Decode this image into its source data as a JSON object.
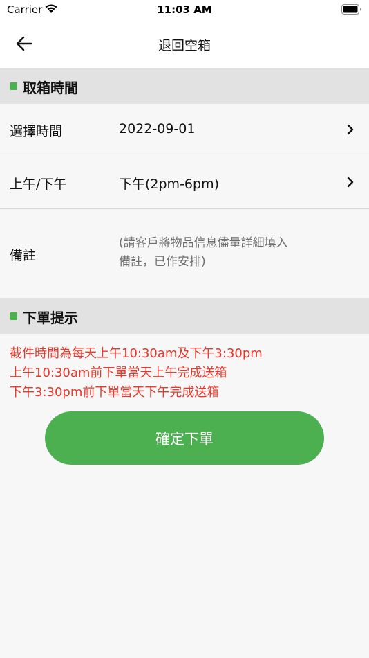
{
  "status_bar": {
    "carrier": "Carrier",
    "time": "11:03 AM"
  },
  "nav": {
    "title": "退回空箱",
    "back_icon": "arrow-left-icon"
  },
  "pickup_section": {
    "title": "取箱時間",
    "rows": [
      {
        "label": "選擇時間",
        "value": "2022-09-01"
      },
      {
        "label": "上午/下午",
        "value": "下午(2pm-6pm)"
      }
    ],
    "remarks": {
      "label": "備註",
      "placeholder_lines": [
        "(請客戶將物品信息儘量詳細填入",
        "備註，已作安排)"
      ]
    }
  },
  "tips_section": {
    "title": "下單提示",
    "lines": [
      "截件時間為每天上午10:30am及下午3:30pm",
      "上午10:30am前下單當天上午完成送箱",
      "下午3:30pm前下單當天下午完成送箱"
    ]
  },
  "confirm_button": {
    "label": "確定下單"
  },
  "colors": {
    "accent": "#4caf50",
    "warning_text": "#e8372b",
    "section_bg": "#e2e2e2",
    "page_bg": "#f7f7f7"
  }
}
